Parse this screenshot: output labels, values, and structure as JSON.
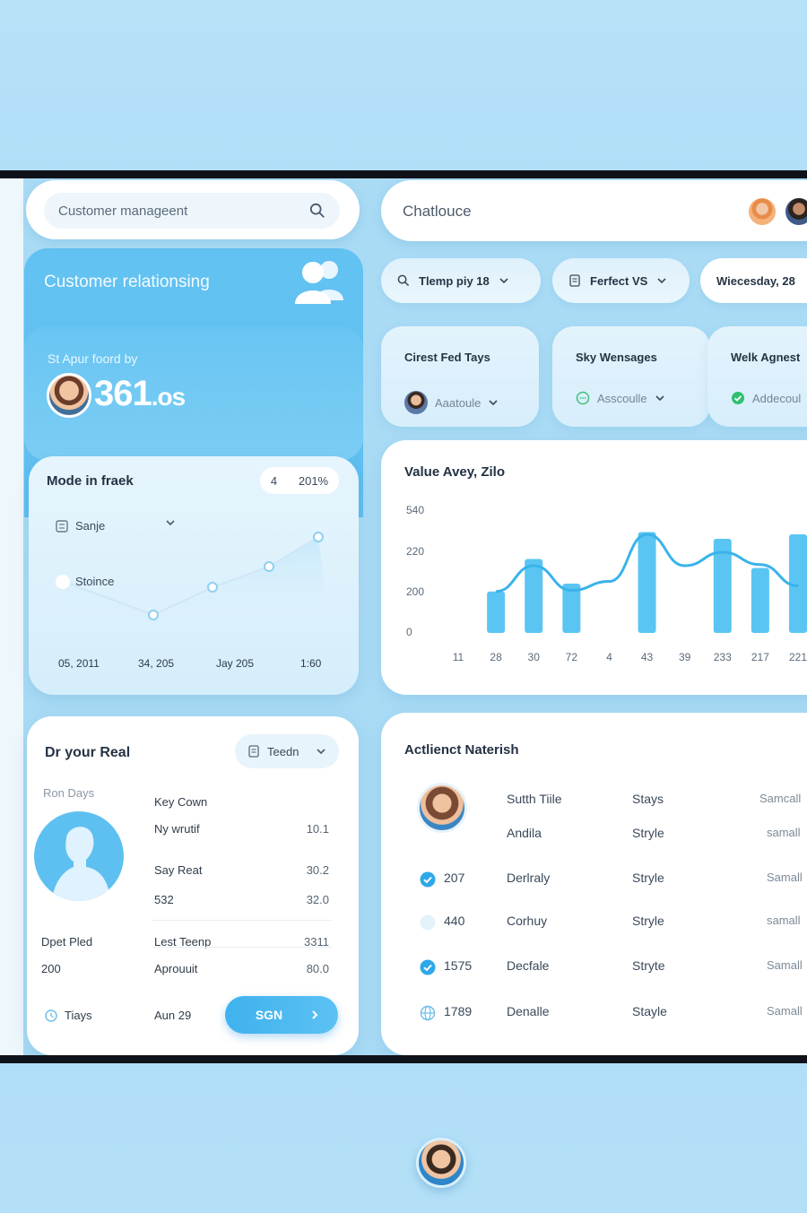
{
  "search": {
    "placeholder": "Customer manageent"
  },
  "hero": {
    "title": "Customer relationsing",
    "label": "St Apur foord by",
    "value_main": "361",
    "value_suffix": ".os"
  },
  "trend": {
    "title": "Mode in fraek",
    "chip_left": "4",
    "chip_right": "201%",
    "select_label": "Sanje",
    "series_label": "Stoince",
    "x_labels": [
      "05, 2011",
      "34, 205",
      "Jay 205",
      "1:60"
    ]
  },
  "detail": {
    "title": "Dr your Real",
    "chip_label": "Teedn",
    "sub": "Ron Days",
    "rows": [
      {
        "label": "Key Cown",
        "value": ""
      },
      {
        "label": "Ny wrutif",
        "value": "10.1"
      },
      {
        "label": "Say Reat",
        "value": "30.2"
      },
      {
        "label": "532",
        "value": "32.0"
      }
    ],
    "lower": [
      {
        "left": "Dpet Pled",
        "label": "Lest Teenp",
        "value": "3311"
      },
      {
        "left": "200",
        "label": "Aprouuit",
        "value": "80.0"
      }
    ],
    "footer_left": "Tiays",
    "footer_date": "Aun 29",
    "button_label": "SGN"
  },
  "chat": {
    "title": "Chatlouce"
  },
  "filters": [
    {
      "label": "Tlemp piy 18"
    },
    {
      "label": "Ferfect VS"
    },
    {
      "label": "Wiecesday, 28"
    }
  ],
  "minis": [
    {
      "title": "Cirest Fed Tays",
      "sub": "Aaatoule"
    },
    {
      "title": "Sky Wensages",
      "sub": "Asscoulle"
    },
    {
      "title": "Welk Agnest",
      "sub": "Addecoul"
    }
  ],
  "chart_data": {
    "type": "bar",
    "title": "Value Avey, Zilo",
    "y_ticks": [
      "540",
      "220",
      "200",
      "0"
    ],
    "categories": [
      "11",
      "28",
      "30",
      "72",
      "4",
      "43",
      "39",
      "233",
      "217",
      "221"
    ],
    "bars": [
      {
        "category": "28",
        "value": 185
      },
      {
        "category": "30",
        "value": 330
      },
      {
        "category": "72",
        "value": 220
      },
      {
        "category": "43",
        "value": 450
      },
      {
        "category": "233",
        "value": 420
      },
      {
        "category": "217",
        "value": 290
      },
      {
        "category": "221",
        "value": 440
      }
    ],
    "line": [
      {
        "x": "28",
        "value": 185
      },
      {
        "x": "30",
        "value": 300
      },
      {
        "x": "72",
        "value": 190
      },
      {
        "x": "4",
        "value": 230
      },
      {
        "x": "43",
        "value": 440
      },
      {
        "x": "39",
        "value": 300
      },
      {
        "x": "233",
        "value": 360
      },
      {
        "x": "217",
        "value": 305
      },
      {
        "x": "221",
        "value": 210
      }
    ],
    "ylim": [
      0,
      520
    ],
    "colors": {
      "bar": "#4cc0f2",
      "line": "#39b3ea"
    }
  },
  "table": {
    "title": "Actlienct Naterish",
    "rows": [
      {
        "id": "",
        "name": "Sutth Tiile",
        "status": "Stays",
        "value": "Samcall"
      },
      {
        "id": "",
        "name": "Andila",
        "status": "Stryle",
        "value": "samall"
      },
      {
        "id": "207",
        "name": "Derlraly",
        "status": "Stryle",
        "value": "Samall"
      },
      {
        "id": "440",
        "name": "Corhuy",
        "status": "Stryle",
        "value": "samall"
      },
      {
        "id": "1575",
        "name": "Decfale",
        "status": "Stryte",
        "value": "Samall"
      },
      {
        "id": "1789",
        "name": "Denalle",
        "status": "Stayle",
        "value": "Samall"
      }
    ]
  }
}
